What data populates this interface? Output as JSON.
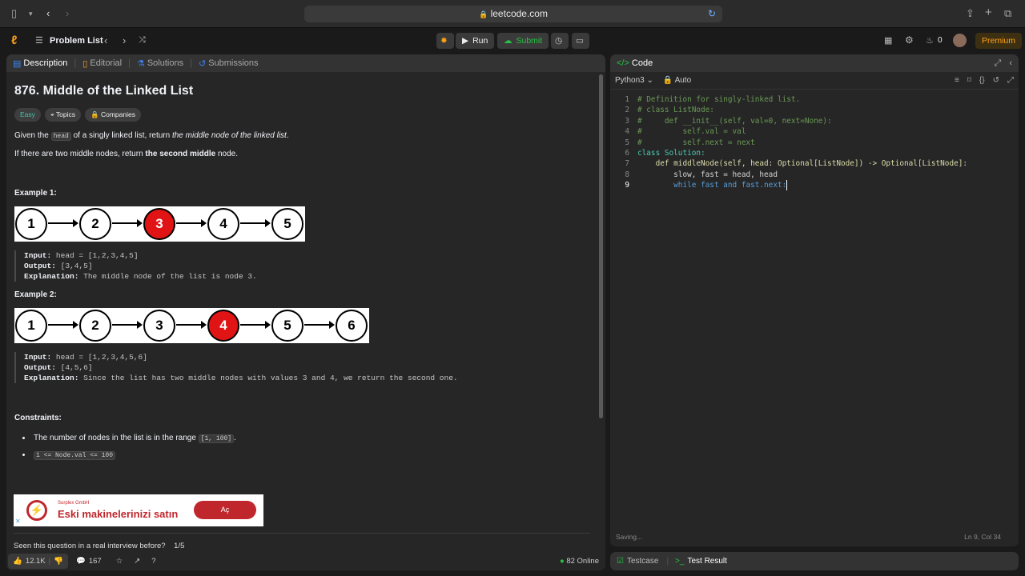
{
  "browser": {
    "url": "leetcode.com"
  },
  "nav": {
    "problem_list": "Problem List",
    "run": "Run",
    "submit": "Submit",
    "streak": "0",
    "premium": "Premium"
  },
  "left_tabs": [
    "Description",
    "Editorial",
    "Solutions",
    "Submissions"
  ],
  "problem": {
    "title": "876. Middle of the Linked List",
    "difficulty": "Easy",
    "topics": "Topics",
    "companies": "Companies",
    "p1a": "Given the ",
    "p1code": "head",
    "p1b": " of a singly linked list, return ",
    "p1em": "the middle node of the linked list",
    "p2a": "If there are two middle nodes, return ",
    "p2b": "the second middle",
    "p2c": " node.",
    "ex1_title": "Example 1:",
    "ex1_nodes": [
      "1",
      "2",
      "3",
      "4",
      "5"
    ],
    "ex1_input_label": "Input:",
    "ex1_input": "head = [1,2,3,4,5]",
    "ex1_output_label": "Output:",
    "ex1_output": "[3,4,5]",
    "ex1_expl_label": "Explanation:",
    "ex1_expl": "The middle node of the list is node 3.",
    "ex2_title": "Example 2:",
    "ex2_nodes": [
      "1",
      "2",
      "3",
      "4",
      "5",
      "6"
    ],
    "ex2_input_label": "Input:",
    "ex2_input": "head = [1,2,3,4,5,6]",
    "ex2_output_label": "Output:",
    "ex2_output": "[4,5,6]",
    "ex2_expl_label": "Explanation:",
    "ex2_expl": "Since the list has two middle nodes with values 3 and 4, we return the second one.",
    "constraints_title": "Constraints:",
    "c1a": "The number of nodes in the list is in the range ",
    "c1code": "[1, 100]",
    "c1b": ".",
    "c2code": "1 <= Node.val <= 100"
  },
  "ad": {
    "company": "Surplex GmbH",
    "headline": "Eski makinelerinizi satın",
    "cta": "Aç"
  },
  "interview": {
    "question": "Seen this question in a real interview before?",
    "page": "1/5"
  },
  "footer": {
    "likes": "12.1K",
    "comments": "167",
    "online": "82 Online"
  },
  "editor": {
    "title": "Code",
    "language": "Python3",
    "auto": "Auto",
    "status": "Saving...",
    "cursor": "Ln 9, Col 34"
  },
  "bottom_tabs": {
    "testcase": "Testcase",
    "result": "Test Result"
  },
  "code_lines": [
    "# Definition for singly-linked list.",
    "# class ListNode:",
    "#     def __init__(self, val=0, next=None):",
    "#         self.val = val",
    "#         self.next = next",
    "class Solution:",
    "    def middleNode(self, head: Optional[ListNode]) -> Optional[ListNode]:",
    "        slow, fast = head, head",
    "        while fast and fast.next:"
  ]
}
